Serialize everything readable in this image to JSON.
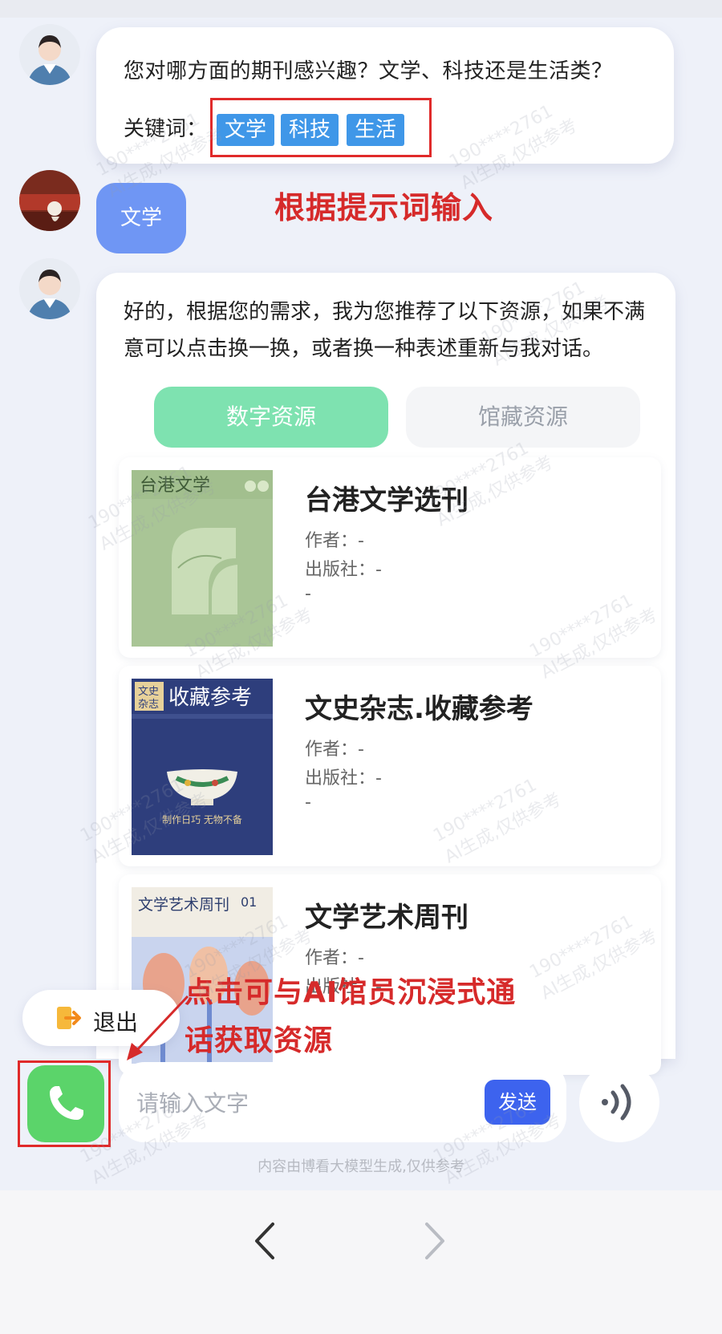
{
  "question": {
    "text": "您对哪方面的期刊感兴趣？文学、科技还是生活类？",
    "keywords_label": "关键词：",
    "keywords": [
      "文学",
      "科技",
      "生活"
    ]
  },
  "annotation_keywords": "根据提示词输入",
  "user_message": "文学",
  "response": {
    "text": "好的，根据您的需求，我为您推荐了以下资源，如果不满意可以点击换一换，或者换一种表述重新与我对话。",
    "tabs": [
      {
        "label": "数字资源",
        "active": true
      },
      {
        "label": "馆藏资源",
        "active": false
      }
    ],
    "books": [
      {
        "title": "台港文学选刊",
        "author": "作者：-",
        "publisher": "出版社：-",
        "extra": "-",
        "cover_text": "台港文学"
      },
      {
        "title": "文史杂志.收藏参考",
        "author": "作者：-",
        "publisher": "出版社：-",
        "extra": "-",
        "cover_text": "收藏参考",
        "cover_badge": "文史\n杂志",
        "cover_caption": "制作日巧 无物不备"
      },
      {
        "title": "文学艺术周刊",
        "author": "作者：-",
        "publisher": "出版社：-",
        "extra": "",
        "cover_text": "文学艺术周刊",
        "cover_issue": "01"
      }
    ]
  },
  "exit_label": "退出",
  "annotation_call": [
    "点击可与AI馆员沉浸式通",
    "话获取资源"
  ],
  "input": {
    "placeholder": "请输入文字",
    "send_label": "发送"
  },
  "disclaimer": "内容由博看大模型生成,仅供参考",
  "watermark": [
    "190****2761",
    "AI生成,仅供参考"
  ],
  "colors": {
    "accent_blue": "#3d63ee",
    "user_bubble": "#6f96f4",
    "tab_active": "#7ee2b0",
    "keyword_chip": "#3f97e8",
    "annotation_red": "#d62a2a",
    "call_green": "#5bd46a"
  },
  "icons": [
    "assistant-avatar",
    "user-avatar",
    "exit-icon",
    "phone-icon",
    "voice-icon",
    "back-arrow-icon",
    "forward-arrow-icon"
  ]
}
